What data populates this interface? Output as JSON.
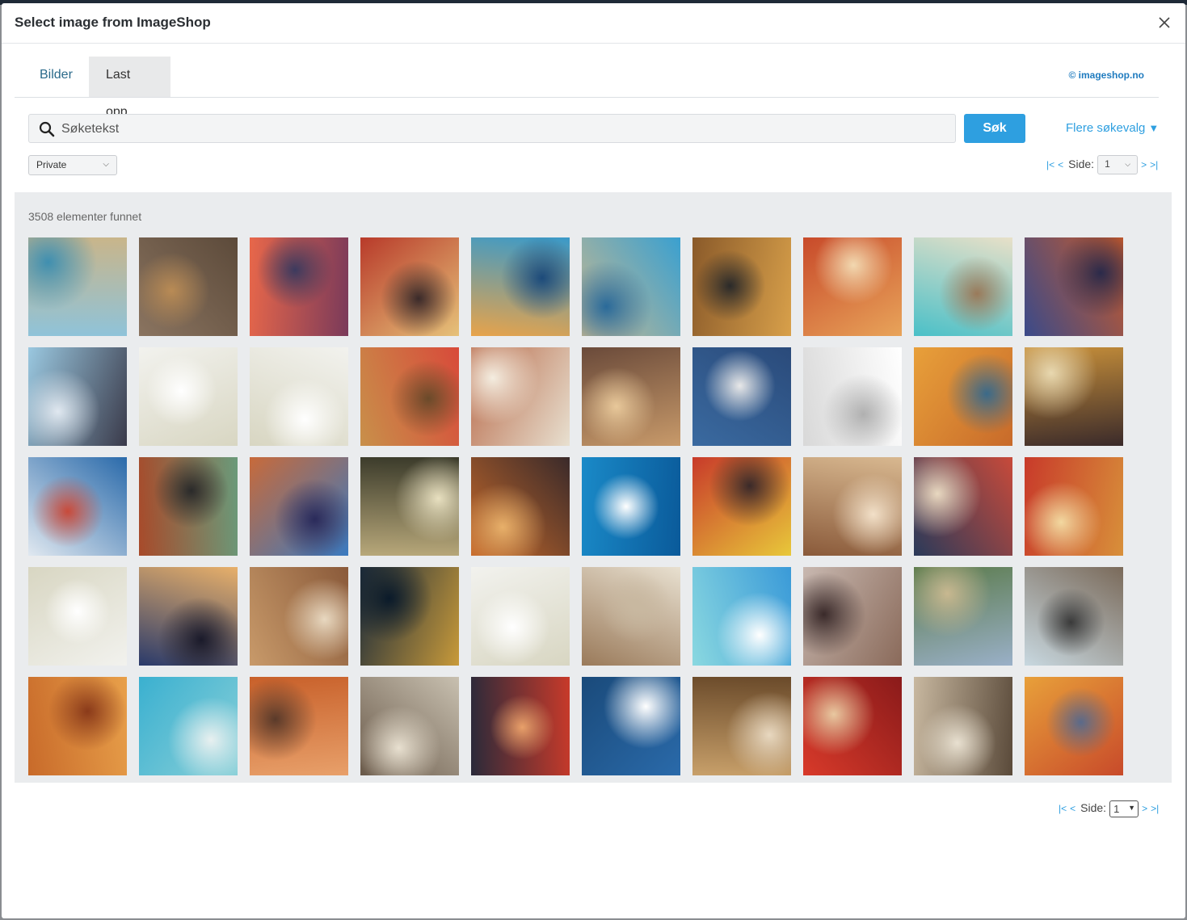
{
  "modal": {
    "title": "Select image from ImageShop",
    "close_label": "×"
  },
  "tabs": [
    {
      "label": "Bilder"
    },
    {
      "label": "Last opp"
    }
  ],
  "brand_link": "© imageshop.no",
  "search": {
    "placeholder": "Søketekst",
    "button_label": "Søk",
    "more_options_label": "Flere søkevalg",
    "more_options_icon": "triangle-down-icon"
  },
  "filter": {
    "selected": "Private"
  },
  "pager": {
    "first": "|<",
    "prev": "<",
    "next": ">",
    "last": ">|",
    "label": "Side:",
    "page": "1"
  },
  "results": {
    "count_text": "3508 elementer funnet",
    "thumbnails": [
      {
        "name": "pool-deck-umbrella",
        "colors": [
          "#8fc3d9",
          "#c9b58a",
          "#3f8fb0"
        ]
      },
      {
        "name": "person-in-brush",
        "colors": [
          "#8a7460",
          "#5c4a3a",
          "#b98b55"
        ]
      },
      {
        "name": "sunset-sea",
        "colors": [
          "#e8674a",
          "#7a3a5a",
          "#3c3a5e"
        ]
      },
      {
        "name": "dining-room-red",
        "colors": [
          "#b83a2a",
          "#e6c27a",
          "#3a2a2a"
        ]
      },
      {
        "name": "lounge-blue-carpet",
        "colors": [
          "#3a9ac9",
          "#e8a34a",
          "#1c4a7a"
        ]
      },
      {
        "name": "ship-pool-aerial",
        "colors": [
          "#3aa0d0",
          "#c8b890",
          "#2a6a9a"
        ]
      },
      {
        "name": "atrium-staircase",
        "colors": [
          "#d8a04a",
          "#8a5a2a",
          "#2a2a2a"
        ]
      },
      {
        "name": "suite-orange",
        "colors": [
          "#e8a45a",
          "#c84a2a",
          "#f2d8b0"
        ]
      },
      {
        "name": "lounge-turquoise",
        "colors": [
          "#4ac0c8",
          "#e8e0c8",
          "#9a7a5a"
        ]
      },
      {
        "name": "bar-panorama",
        "colors": [
          "#3a4a8a",
          "#c85a2a",
          "#2a2a4a"
        ]
      },
      {
        "name": "yoga-class",
        "colors": [
          "#9ac8e0",
          "#3a3a4a",
          "#e0e8f0"
        ]
      },
      {
        "name": "world-map-route",
        "colors": [
          "#f2f2ee",
          "#d8d6c2",
          "#ffffff"
        ]
      },
      {
        "name": "world-map-asia",
        "colors": [
          "#f2f2ee",
          "#d8d6c2",
          "#ffffff"
        ]
      },
      {
        "name": "cabin-red-sofa",
        "colors": [
          "#d84a3a",
          "#c8904a",
          "#6a4a2a"
        ]
      },
      {
        "name": "cabin-bed",
        "colors": [
          "#e8e0d0",
          "#b86a4a",
          "#f4ede0"
        ]
      },
      {
        "name": "shopping-promenade",
        "colors": [
          "#c89a6a",
          "#6a4a3a",
          "#e8c89a"
        ]
      },
      {
        "name": "eagle-water",
        "colors": [
          "#3a6aa0",
          "#2a4a7a",
          "#e8e8e8"
        ]
      },
      {
        "name": "map-europe-route",
        "colors": [
          "#d8d8d8",
          "#ffffff",
          "#b0b0b0"
        ]
      },
      {
        "name": "restaurant-yellow",
        "colors": [
          "#e8a03a",
          "#c86a2a",
          "#3a6a8a"
        ]
      },
      {
        "name": "dining-chandelier",
        "colors": [
          "#c8903a",
          "#3a2a2a",
          "#e8d8b0"
        ]
      },
      {
        "name": "ship-deck-pool-sea",
        "colors": [
          "#2a6aaa",
          "#e0e8f0",
          "#c84a3a"
        ]
      },
      {
        "name": "pirate-ship-model",
        "colors": [
          "#6a9a7a",
          "#a84a2a",
          "#2a2a2a"
        ]
      },
      {
        "name": "observation-lounge",
        "colors": [
          "#3a7ac0",
          "#c86a3a",
          "#2a2a5a"
        ]
      },
      {
        "name": "seahorse-sculpture",
        "colors": [
          "#b8a87a",
          "#3a3a2a",
          "#e8e0c0"
        ]
      },
      {
        "name": "bar-stools",
        "colors": [
          "#c86a2a",
          "#3a2a2a",
          "#e8b06a"
        ]
      },
      {
        "name": "cruise-ship-blue",
        "colors": [
          "#1a8ac8",
          "#0a5a9a",
          "#ffffff"
        ]
      },
      {
        "name": "atrium-from-above",
        "colors": [
          "#c83a2a",
          "#e8c83a",
          "#3a2a2a"
        ]
      },
      {
        "name": "cabin-beige",
        "colors": [
          "#d8b890",
          "#8a5a3a",
          "#f2e0c8"
        ]
      },
      {
        "name": "lounge-red-chairs",
        "colors": [
          "#c84a3a",
          "#2a3a5a",
          "#e8d8c0"
        ]
      },
      {
        "name": "suite-red",
        "colors": [
          "#d8903a",
          "#c83a2a",
          "#f2d8a0"
        ]
      },
      {
        "name": "world-map-atlantic",
        "colors": [
          "#f2f2ee",
          "#d8d6c2",
          "#ffffff"
        ]
      },
      {
        "name": "city-night-harbor",
        "colors": [
          "#2a3a6a",
          "#e8b06a",
          "#1a1a2a"
        ]
      },
      {
        "name": "cabin-window",
        "colors": [
          "#c89a6a",
          "#8a5a3a",
          "#e8d8c0"
        ]
      },
      {
        "name": "harbor-night",
        "colors": [
          "#1a2a3a",
          "#c89a3a",
          "#0a1a2a"
        ]
      },
      {
        "name": "world-map-pacific",
        "colors": [
          "#f2f2ee",
          "#d8d6c2",
          "#ffffff"
        ]
      },
      {
        "name": "hat-on-bed",
        "colors": [
          "#e8e0d0",
          "#9a7a5a",
          "#c8b8a0"
        ]
      },
      {
        "name": "beach-turquoise",
        "colors": [
          "#3a9ad8",
          "#8ad8e0",
          "#ffffff"
        ]
      },
      {
        "name": "deck-promenade",
        "colors": [
          "#8a6a5a",
          "#c8b8b0",
          "#3a2a2a"
        ]
      },
      {
        "name": "vienna-gardens",
        "colors": [
          "#9ab0c8",
          "#5a7a4a",
          "#c8b890"
        ]
      },
      {
        "name": "suite-bed-window",
        "colors": [
          "#c8d8e0",
          "#7a6a5a",
          "#3a3a3a"
        ]
      },
      {
        "name": "anthurium-flowers",
        "colors": [
          "#c86a2a",
          "#e8a04a",
          "#8a3a1a"
        ]
      },
      {
        "name": "aerial-lagoon",
        "colors": [
          "#3ab0d0",
          "#8ad0d8",
          "#e8f0f0"
        ]
      },
      {
        "name": "cabin-orange-bed",
        "colors": [
          "#c8602a",
          "#e8a06a",
          "#5a3a2a"
        ]
      },
      {
        "name": "cabin-balcony",
        "colors": [
          "#c8c0b0",
          "#6a5a4a",
          "#e8e0d0"
        ]
      },
      {
        "name": "lounge-red-carpet",
        "colors": [
          "#c83a2a",
          "#2a2a3a",
          "#e8a06a"
        ]
      },
      {
        "name": "cruise-ship-aerial",
        "colors": [
          "#2a6aaa",
          "#1a4a7a",
          "#ffffff"
        ]
      },
      {
        "name": "waiter-dining",
        "colors": [
          "#c8a06a",
          "#6a4a2a",
          "#e8d8c0"
        ]
      },
      {
        "name": "bar-red-stools",
        "colors": [
          "#d83a2a",
          "#8a1a1a",
          "#e8c8a0"
        ]
      },
      {
        "name": "suite-desk",
        "colors": [
          "#c8b8a0",
          "#5a4a3a",
          "#e8e0d0"
        ]
      },
      {
        "name": "lounge-orange-sofa",
        "colors": [
          "#e8a03a",
          "#c84a2a",
          "#5a6a8a"
        ]
      }
    ]
  }
}
